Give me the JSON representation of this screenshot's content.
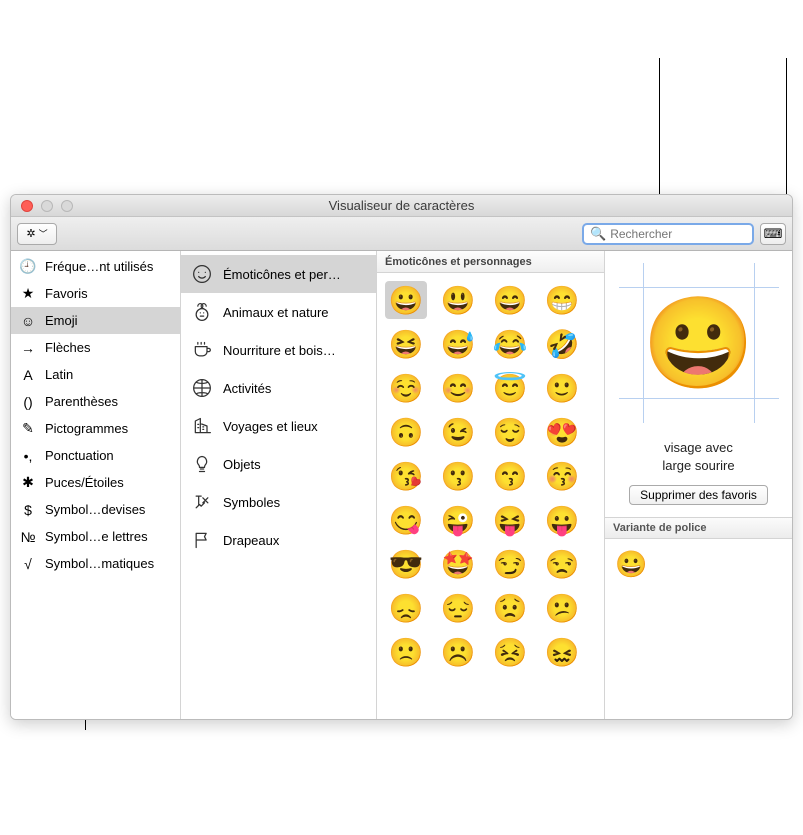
{
  "window": {
    "title": "Visualiseur de caractères"
  },
  "search": {
    "placeholder": "Rechercher"
  },
  "sidebar1": [
    {
      "icon": "🕘",
      "label": "Fréque…nt utilisés"
    },
    {
      "icon": "★",
      "label": "Favoris"
    },
    {
      "icon": "☺",
      "label": "Emoji",
      "selected": true
    },
    {
      "icon": "→",
      "label": "Flèches"
    },
    {
      "icon": "A",
      "label": "Latin"
    },
    {
      "icon": "()",
      "label": "Parenthèses"
    },
    {
      "icon": "✎",
      "label": "Pictogrammes"
    },
    {
      "icon": "•,",
      "label": "Ponctuation"
    },
    {
      "icon": "✱",
      "label": "Puces/Étoiles"
    },
    {
      "icon": "$",
      "label": "Symbol…devises"
    },
    {
      "icon": "№",
      "label": "Symbol…e lettres"
    },
    {
      "icon": "√",
      "label": "Symbol…matiques"
    }
  ],
  "sidebar2": [
    {
      "label": "Émoticônes et per…",
      "selected": true,
      "icon": "smiley"
    },
    {
      "label": "Animaux et nature",
      "icon": "bear"
    },
    {
      "label": "Nourriture et bois…",
      "icon": "cup"
    },
    {
      "label": "Activités",
      "icon": "ball"
    },
    {
      "label": "Voyages et lieux",
      "icon": "building"
    },
    {
      "label": "Objets",
      "icon": "bulb"
    },
    {
      "label": "Symboles",
      "icon": "symbols"
    },
    {
      "label": "Drapeaux",
      "icon": "flag"
    }
  ],
  "grid": {
    "header": "Émoticônes et personnages",
    "emojis": [
      "😀",
      "😃",
      "😄",
      "😁",
      "😆",
      "😅",
      "😂",
      "🤣",
      "☺️",
      "😊",
      "😇",
      "🙂",
      "🙃",
      "😉",
      "😌",
      "😍",
      "😘",
      "😗",
      "😙",
      "😚",
      "😋",
      "😜",
      "😝",
      "😛",
      "😎",
      "🤩",
      "😏",
      "😒",
      "😞",
      "😔",
      "😟",
      "😕",
      "🙁",
      "☹️",
      "😣",
      "😖"
    ]
  },
  "detail": {
    "selected_emoji": "😀",
    "name_line1": "visage avec",
    "name_line2": "large sourire",
    "remove_label": "Supprimer des favoris",
    "variant_header": "Variante de police",
    "variant_emoji": "😀"
  }
}
